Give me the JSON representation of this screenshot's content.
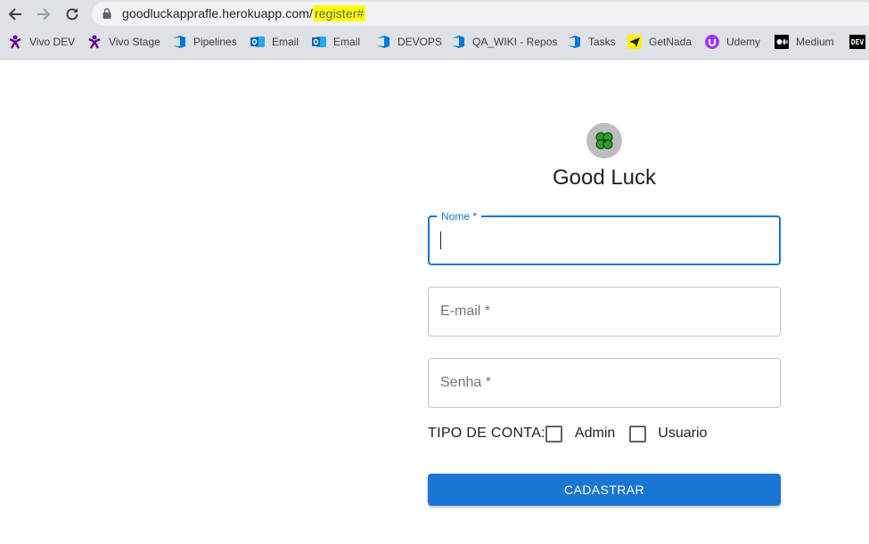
{
  "browser": {
    "url_host": "goodluckapprafle.herokuapp.com/",
    "url_path": "register#",
    "bookmarks": [
      {
        "label": "Vivo DEV",
        "icon": "vivo-icon"
      },
      {
        "label": "Vivo Stage",
        "icon": "vivo-icon"
      },
      {
        "label": "Pipelines",
        "icon": "azure-devops-icon"
      },
      {
        "label": "Email",
        "icon": "outlook-icon"
      },
      {
        "label": "Email",
        "icon": "outlook-icon"
      },
      {
        "label": "DEVOPS",
        "icon": "azure-devops-icon"
      },
      {
        "label": "QA_WIKI - Repos",
        "icon": "azure-devops-icon"
      },
      {
        "label": "Tasks",
        "icon": "azure-devops-icon"
      },
      {
        "label": "GetNada",
        "icon": "getnada-icon"
      },
      {
        "label": "Udemy",
        "icon": "udemy-icon"
      },
      {
        "label": "Medium",
        "icon": "medium-icon"
      },
      {
        "label": "DEV",
        "icon": "dev-icon"
      }
    ]
  },
  "page": {
    "title": "Good Luck",
    "logo_icon": "clover-icon",
    "fields": {
      "name_label": "Nome *",
      "name_value": "",
      "email_placeholder": "E-mail *",
      "password_placeholder": "Senha *"
    },
    "account_type": {
      "label": "TIPO DE CONTA:",
      "options": [
        "Admin",
        "Usuario"
      ]
    },
    "submit_label": "CADASTRAR"
  },
  "colors": {
    "primary": "#1976d2",
    "url_highlight": "#ffff00",
    "logo_bg": "#bdbdbd",
    "clover": "#2e9e2e"
  }
}
